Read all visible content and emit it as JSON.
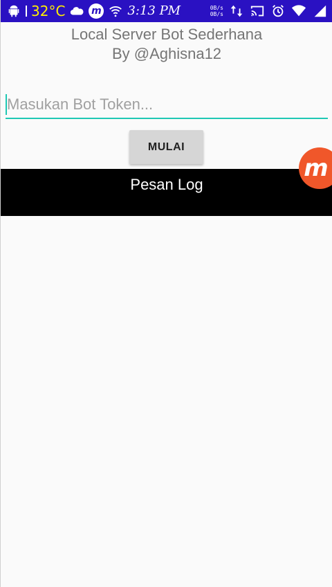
{
  "status_bar": {
    "temperature": "32°C",
    "time": "3:13 PM",
    "net_up": "0B/s",
    "net_down": "0B/s",
    "carrier_glyph": "m",
    "icons": [
      "android-debug-icon",
      "cloud-icon",
      "m-app-icon",
      "wifi-icon",
      "signal-icon",
      "data-arrows-icon",
      "cast-icon",
      "alarm-icon",
      "wifi-full-icon",
      "signal-full-icon"
    ]
  },
  "header": {
    "title_line1": "Local Server Bot Sederhana",
    "title_line2": "By @Aghisna12"
  },
  "token_input": {
    "placeholder": "Masukan Bot Token...",
    "value": ""
  },
  "start_button": {
    "label": "MULAI"
  },
  "log": {
    "title": "Pesan Log"
  },
  "floating_badge": {
    "glyph": "m"
  },
  "colors": {
    "status_bar": "#2a11c2",
    "accent": "#1ec8b4",
    "badge": "#f0572a",
    "temperature": "#ffee00"
  }
}
